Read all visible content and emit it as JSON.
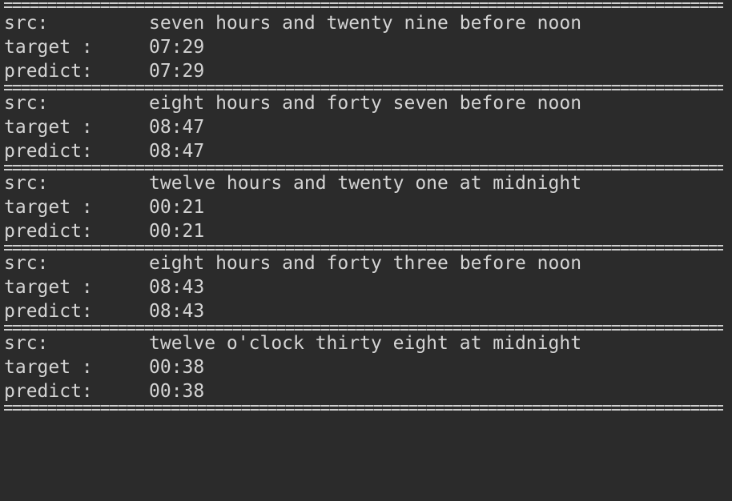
{
  "entries": [
    {
      "src_label": "src:",
      "target_label": "target :",
      "predict_label": "predict:",
      "src": "seven hours and twenty nine before noon",
      "target": "07:29",
      "predict": "07:29"
    },
    {
      "src_label": "src:",
      "target_label": "target :",
      "predict_label": "predict:",
      "src": "eight hours and forty seven before noon",
      "target": "08:47",
      "predict": "08:47"
    },
    {
      "src_label": "src:",
      "target_label": "target :",
      "predict_label": "predict:",
      "src": "twelve hours and twenty one at midnight",
      "target": "00:21",
      "predict": "00:21"
    },
    {
      "src_label": "src:",
      "target_label": "target :",
      "predict_label": "predict:",
      "src": "eight hours and forty three before noon",
      "target": "08:43",
      "predict": "08:43"
    },
    {
      "src_label": "src:",
      "target_label": "target :",
      "predict_label": "predict:",
      "src": "twelve o'clock thirty eight at midnight",
      "target": "00:38",
      "predict": "00:38"
    }
  ]
}
